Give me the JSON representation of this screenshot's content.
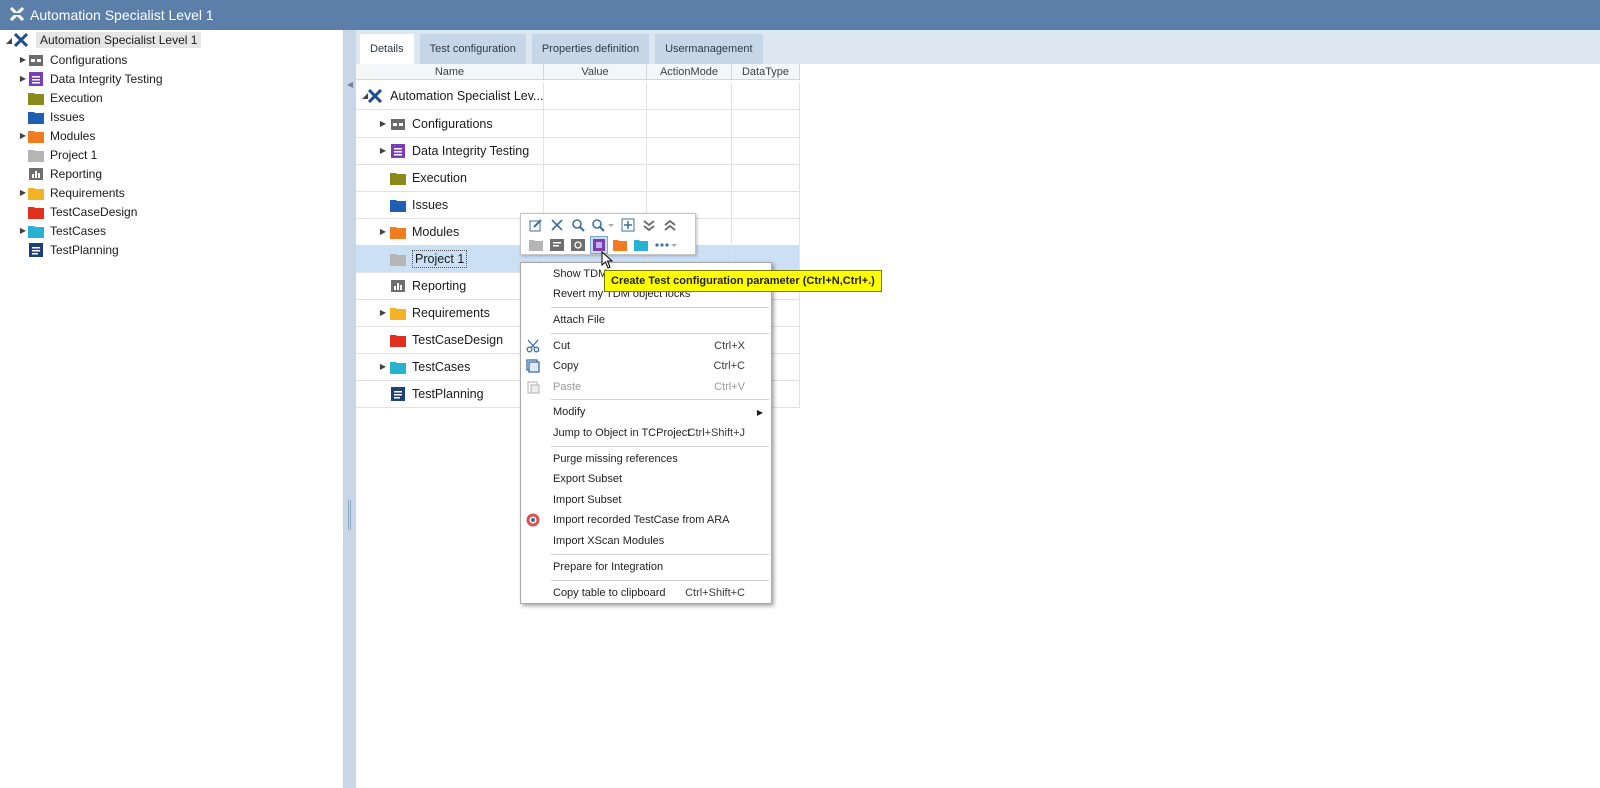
{
  "window": {
    "title": "Automation Specialist Level 1"
  },
  "colors": {
    "titlebar": "#5b7fa8",
    "configurations": "#6b6b6b",
    "data_integrity": "#7a3db8",
    "execution": "#8a8a1c",
    "issues": "#1f5fb3",
    "modules": "#f07c1f",
    "project": "#b5b5b5",
    "reporting": "#6e6e6e",
    "requirements": "#f2b325",
    "testcasedesign": "#e0301e",
    "testcases": "#27b2d1",
    "testplanning": "#1f3f7a",
    "tooltip": "#ffff00",
    "selection": "#cce0f5"
  },
  "tree": {
    "root": "Automation Specialist Level 1",
    "items": [
      {
        "label": "Configurations",
        "icon": "configurations-icon",
        "expandable": true
      },
      {
        "label": "Data Integrity Testing",
        "icon": "data-integrity-icon",
        "expandable": true
      },
      {
        "label": "Execution",
        "icon": "execution-folder-icon",
        "expandable": false
      },
      {
        "label": "Issues",
        "icon": "issues-folder-icon",
        "expandable": false
      },
      {
        "label": "Modules",
        "icon": "modules-folder-icon",
        "expandable": true
      },
      {
        "label": "Project 1",
        "icon": "project-folder-icon",
        "expandable": false
      },
      {
        "label": "Reporting",
        "icon": "reporting-icon",
        "expandable": false
      },
      {
        "label": "Requirements",
        "icon": "requirements-folder-icon",
        "expandable": true
      },
      {
        "label": "TestCaseDesign",
        "icon": "testcasedesign-folder-icon",
        "expandable": false
      },
      {
        "label": "TestCases",
        "icon": "testcases-folder-icon",
        "expandable": true
      },
      {
        "label": "TestPlanning",
        "icon": "testplanning-icon",
        "expandable": false
      }
    ]
  },
  "tabs": [
    "Details",
    "Test configuration",
    "Properties definition",
    "Usermanagement"
  ],
  "grid": {
    "columns": [
      "Name",
      "Value",
      "ActionMode",
      "DataType"
    ],
    "root": "Automation Specialist Lev...",
    "rows": [
      {
        "label": "Configurations"
      },
      {
        "label": "Data Integrity Testing"
      },
      {
        "label": "Execution"
      },
      {
        "label": "Issues"
      },
      {
        "label": "Modules"
      },
      {
        "label": "Project 1"
      },
      {
        "label": "Reporting"
      },
      {
        "label": "Requirements"
      },
      {
        "label": "TestCaseDesign"
      },
      {
        "label": "TestCases"
      },
      {
        "label": "TestPlanning"
      }
    ]
  },
  "quickbar": {
    "row1": [
      "edit-icon",
      "delete-icon",
      "search-icon",
      "search-advanced-icon",
      "add-icon",
      "expand-all-icon",
      "collapse-all-icon"
    ],
    "row2": [
      "grey-folder-icon",
      "test-config-icon",
      "search-folder-icon",
      "create-test-config-param-icon",
      "orange-folder-icon",
      "teal-folder-icon",
      "more-icon"
    ]
  },
  "context_menu": {
    "items": [
      {
        "label": "Show TDM",
        "shortcut": ""
      },
      {
        "label": "Revert my TDM object locks",
        "shortcut": ""
      },
      {
        "label": "Attach File",
        "shortcut": ""
      },
      {
        "label": "Cut",
        "shortcut": "Ctrl+X"
      },
      {
        "label": "Copy",
        "shortcut": "Ctrl+C"
      },
      {
        "label": "Paste",
        "shortcut": "Ctrl+V"
      },
      {
        "label": "Modify",
        "shortcut": ""
      },
      {
        "label": "Jump to Object in TCProject",
        "shortcut": "Ctrl+Shift+J"
      },
      {
        "label": "Purge missing references",
        "shortcut": ""
      },
      {
        "label": "Export Subset",
        "shortcut": ""
      },
      {
        "label": "Import Subset",
        "shortcut": ""
      },
      {
        "label": "Import recorded TestCase from ARA",
        "shortcut": ""
      },
      {
        "label": "Import XScan Modules",
        "shortcut": ""
      },
      {
        "label": "Prepare for Integration",
        "shortcut": ""
      },
      {
        "label": "Copy table to clipboard",
        "shortcut": "Ctrl+Shift+C"
      }
    ]
  },
  "tooltip": {
    "text": "Create Test configuration parameter (Ctrl+N,Ctrl+.)"
  }
}
